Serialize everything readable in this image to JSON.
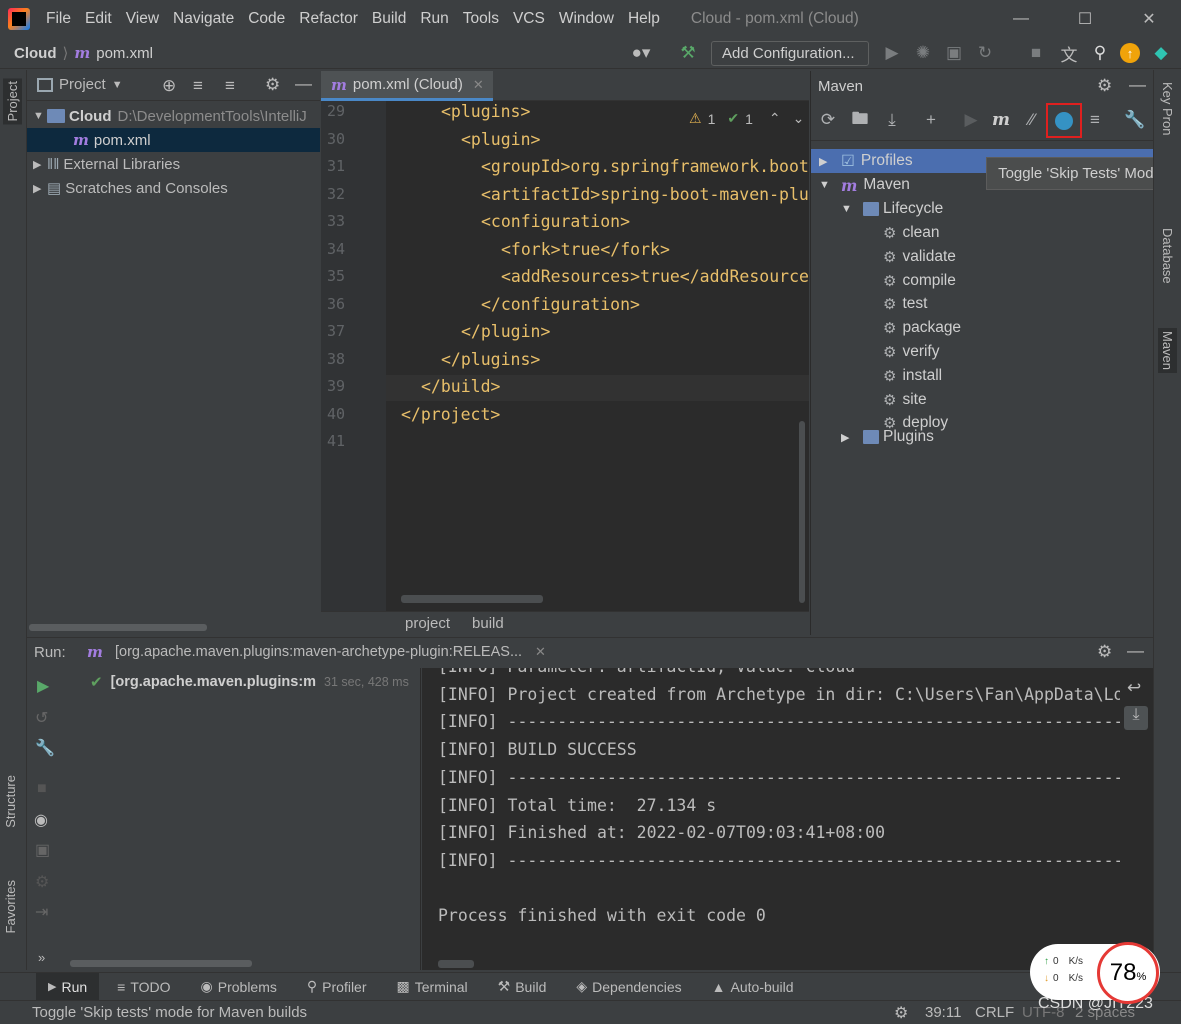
{
  "menubar": {
    "items": [
      "File",
      "Edit",
      "View",
      "Navigate",
      "Code",
      "Refactor",
      "Build",
      "Run",
      "Tools",
      "VCS",
      "Window",
      "Help"
    ],
    "window_title": "Cloud - pom.xml (Cloud)"
  },
  "navbar": {
    "project": "Cloud",
    "file": "pom.xml",
    "add_configuration": "Add Configuration..."
  },
  "project_panel": {
    "title": "Project",
    "root_name": "Cloud",
    "root_path": "D:\\DevelopmentTools\\IntelliJ",
    "file": "pom.xml",
    "external": "External Libraries",
    "scratches": "Scratches and Consoles"
  },
  "left_stripe": {
    "project": "Project",
    "structure": "Structure",
    "favorites": "Favorites"
  },
  "editor": {
    "tab": "pom.xml (Cloud)",
    "warnings": "1",
    "checks": "1",
    "lines": [
      {
        "n": "29",
        "indent": 2,
        "text": "<plugins>"
      },
      {
        "n": "30",
        "indent": 3,
        "text": "<plugin>"
      },
      {
        "n": "31",
        "indent": 4,
        "text": "<groupId>org.springframework.boot"
      },
      {
        "n": "32",
        "indent": 4,
        "text": "<artifactId>spring-boot-maven-plu"
      },
      {
        "n": "33",
        "indent": 4,
        "text": "<configuration>"
      },
      {
        "n": "34",
        "indent": 5,
        "text": "<fork>true</fork>"
      },
      {
        "n": "35",
        "indent": 5,
        "text": "<addResources>true</addResource"
      },
      {
        "n": "36",
        "indent": 4,
        "text": "</configuration>"
      },
      {
        "n": "37",
        "indent": 3,
        "text": "</plugin>"
      },
      {
        "n": "38",
        "indent": 2,
        "text": "</plugins>"
      },
      {
        "n": "39",
        "indent": 1,
        "text": "</build>"
      },
      {
        "n": "40",
        "indent": 0,
        "text": "</project>"
      },
      {
        "n": "41",
        "indent": 0,
        "text": ""
      }
    ],
    "breadcrumb": [
      "project",
      "build"
    ]
  },
  "maven": {
    "title": "Maven",
    "profiles": "Profiles",
    "root": "Maven",
    "lifecycle": "Lifecycle",
    "goals": [
      "clean",
      "validate",
      "compile",
      "test",
      "package",
      "verify",
      "install",
      "site",
      "deploy"
    ],
    "plugins": "Plugins"
  },
  "tooltip": "Toggle 'Skip Tests' Mode",
  "right_stripe": {
    "key": "Key Pron",
    "database": "Database",
    "maven": "Maven"
  },
  "run": {
    "label": "Run:",
    "config": "[org.apache.maven.plugins:maven-archetype-plugin:RELEAS...",
    "node": "[org.apache.maven.plugins:m",
    "time": "31 sec, 428 ms"
  },
  "console": [
    "[INFO] Parameter: artifactId, Value: cloud",
    "[INFO] Project created from Archetype in dir: C:\\Users\\Fan\\AppData\\Lo",
    "[INFO] ------------------------------------------------------------------------",
    "[INFO] BUILD SUCCESS",
    "[INFO] ------------------------------------------------------------------------",
    "[INFO] Total time:  27.134 s",
    "[INFO] Finished at: 2022-02-07T09:03:41+08:00",
    "[INFO] ------------------------------------------------------------------------",
    "",
    "Process finished with exit code 0"
  ],
  "toolwindows": [
    "Run",
    "TODO",
    "Problems",
    "Profiler",
    "Terminal",
    "Build",
    "Dependencies",
    "Auto-build"
  ],
  "status": {
    "message": "Toggle 'Skip tests' mode for Maven builds",
    "position": "39:11",
    "line_sep": "CRLF",
    "encoding": "UTF-8",
    "indent": "2 spaces",
    "watermark": "CSDN @JIT223"
  },
  "overlay": {
    "up": "0",
    "down": "0",
    "unit": "K/s",
    "percent": "78",
    "percent_sign": "%"
  }
}
